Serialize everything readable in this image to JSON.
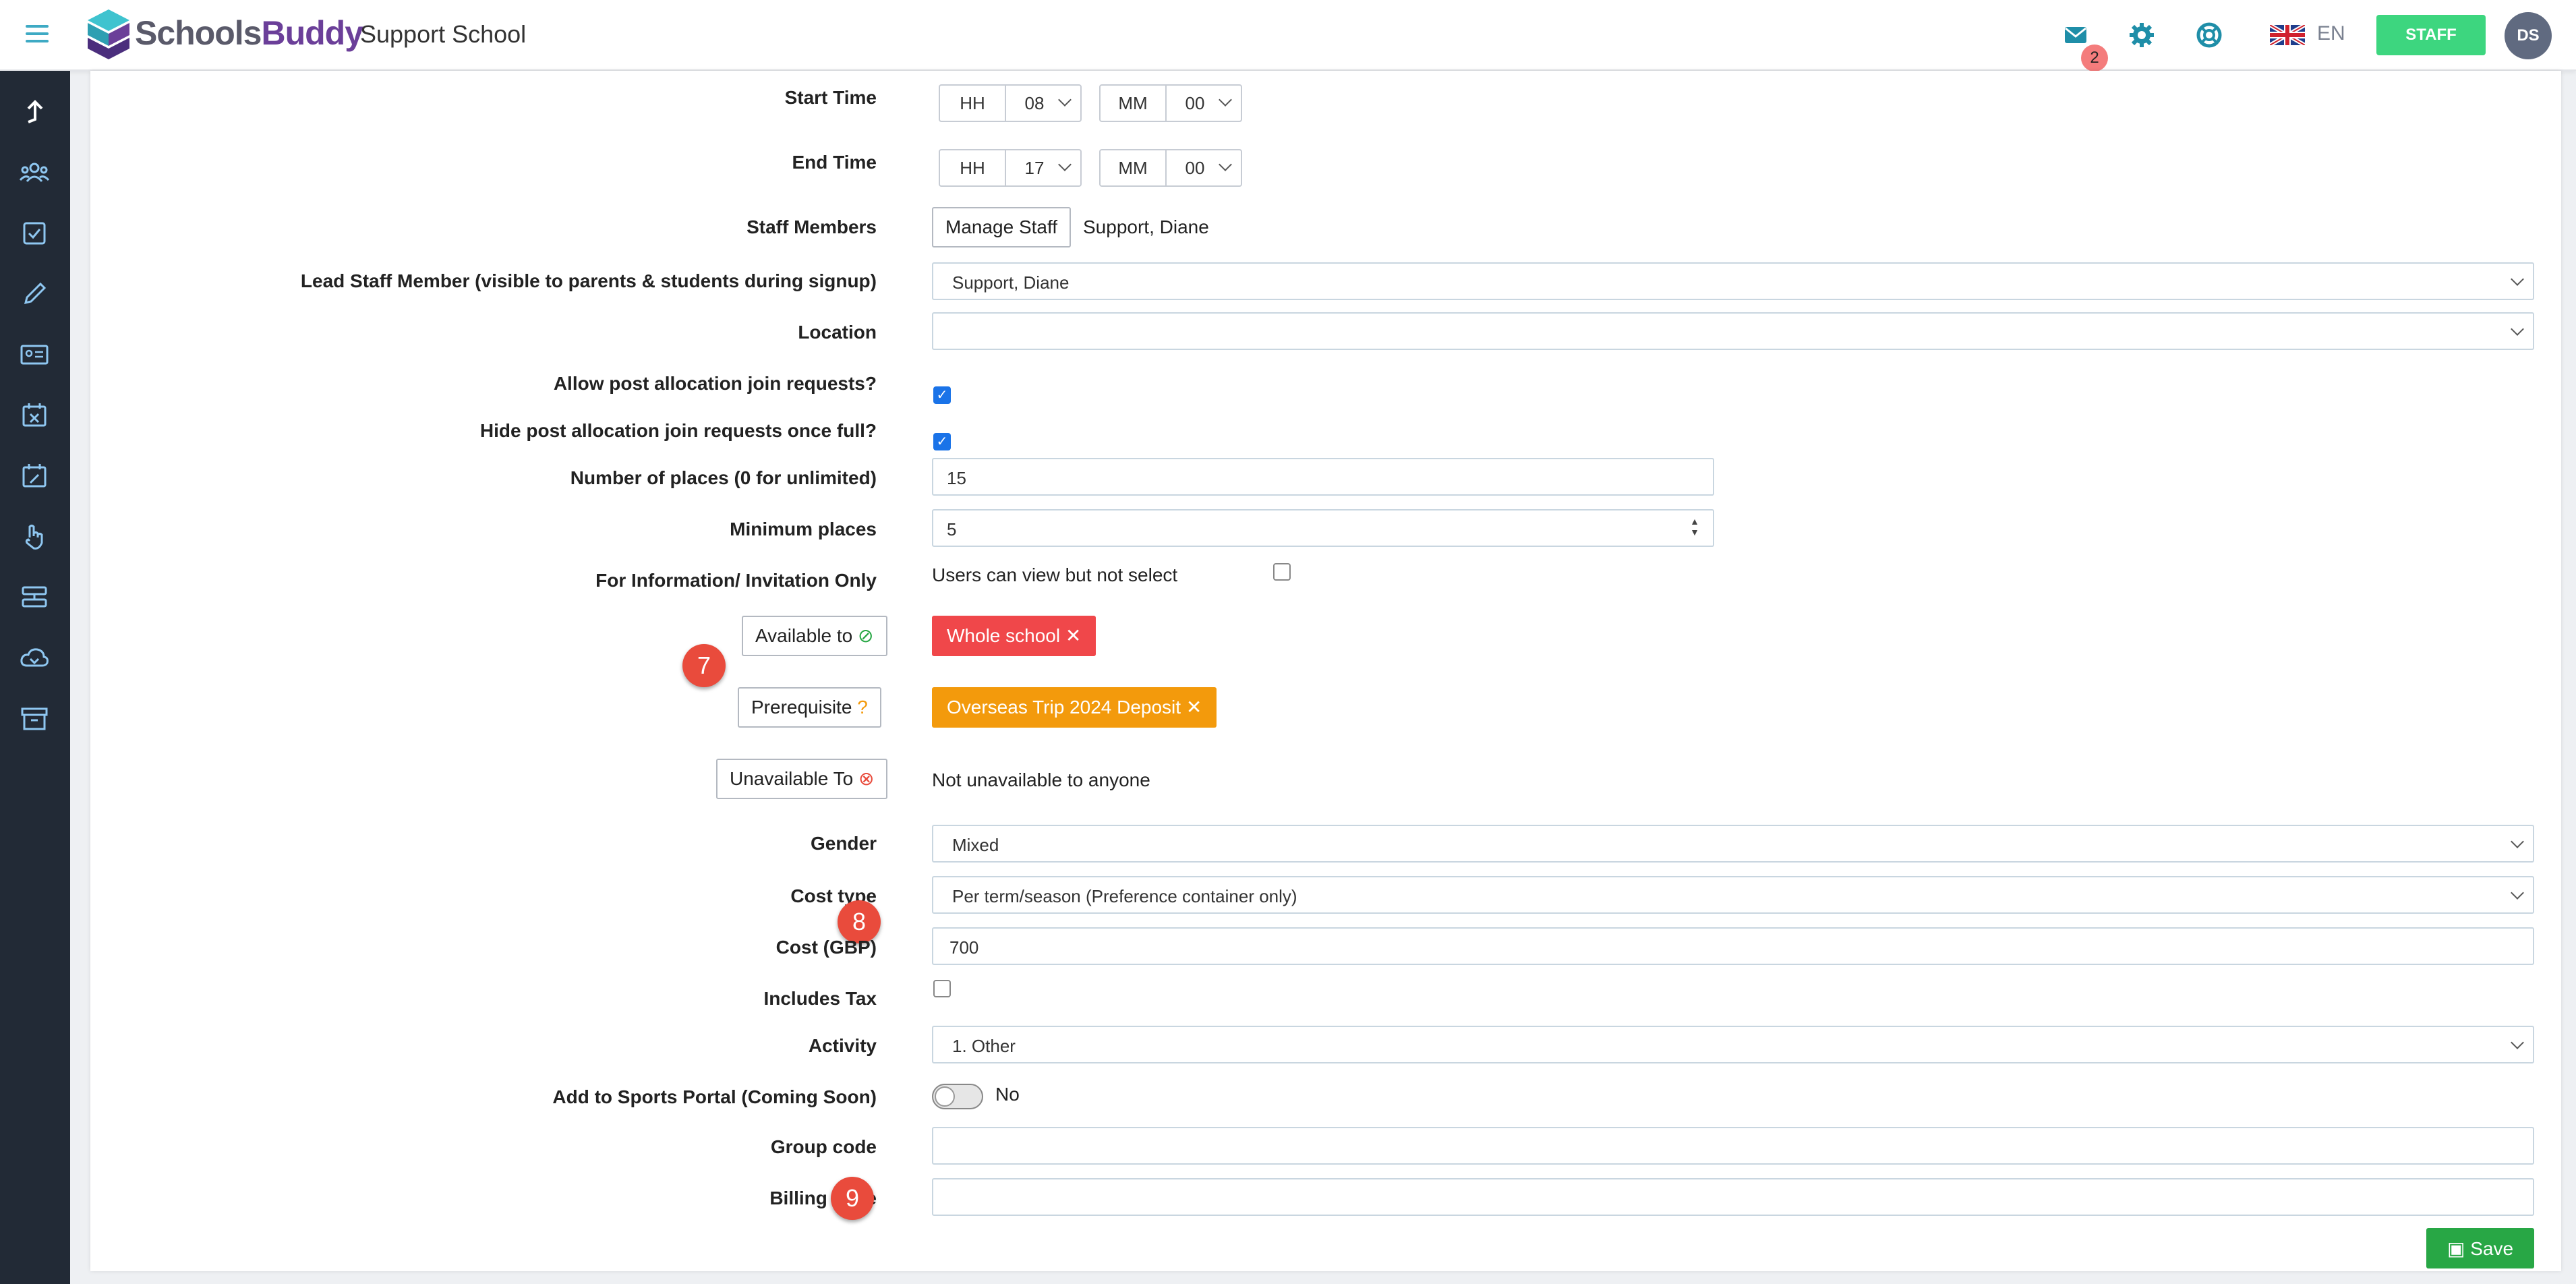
{
  "header": {
    "brand_part1": "Schools",
    "brand_part2": "Buddy",
    "school_name": "Support School",
    "notifications_count": "2",
    "language": "EN",
    "staff_label": "STAFF",
    "user_initials": "DS"
  },
  "sidebar": {
    "icons": [
      "up-arrow-icon",
      "group-icon",
      "checklist-icon",
      "pencil-icon",
      "id-card-icon",
      "calendar-cancel-icon",
      "calendar-edit-icon",
      "hand-icon",
      "server-icon",
      "cloud-download-icon",
      "archive-icon"
    ]
  },
  "form": {
    "start_time": {
      "label": "Start Time",
      "hour_prefix": "HH",
      "hour": "08",
      "min_prefix": "MM",
      "minute": "00"
    },
    "end_time": {
      "label": "End Time",
      "hour_prefix": "HH",
      "hour": "17",
      "min_prefix": "MM",
      "minute": "00"
    },
    "staff_members": {
      "label": "Staff Members",
      "button": "Manage Staff",
      "value": "Support, Diane"
    },
    "lead_staff": {
      "label": "Lead Staff Member (visible to parents & students during signup)",
      "value": "Support, Diane"
    },
    "location": {
      "label": "Location",
      "value": ""
    },
    "allow_post": {
      "label": "Allow post allocation join requests?",
      "checked": true
    },
    "hide_post": {
      "label": "Hide post allocation join requests once full?",
      "checked": true
    },
    "places": {
      "label": "Number of places (0 for unlimited)",
      "value": "15"
    },
    "min_places": {
      "label": "Minimum places",
      "value": "5"
    },
    "info_only": {
      "label": "For Information/ Invitation Only",
      "text": "Users can view but not select",
      "checked": false
    },
    "available_to": {
      "button": "Available to",
      "tag": "Whole school",
      "tag_color": "#f0474a"
    },
    "prerequisite": {
      "button": "Prerequisite",
      "tag": "Overseas Trip 2024 Deposit",
      "tag_color": "#f39a0c"
    },
    "unavailable_to": {
      "button": "Unavailable To",
      "text": "Not unavailable to anyone"
    },
    "gender": {
      "label": "Gender",
      "value": "Mixed"
    },
    "cost_type": {
      "label": "Cost type",
      "value": "Per term/season (Preference container only)"
    },
    "cost": {
      "label": "Cost (GBP)",
      "value": "700"
    },
    "includes_tax": {
      "label": "Includes Tax",
      "checked": false
    },
    "activity": {
      "label": "Activity",
      "value": "1. Other"
    },
    "sports_portal": {
      "label": "Add to Sports Portal (Coming Soon)",
      "state": "No"
    },
    "group_code": {
      "label": "Group code",
      "value": ""
    },
    "billing_code": {
      "label": "Billing code",
      "value": ""
    },
    "save_label": "Save"
  },
  "markers": [
    "7",
    "8",
    "9"
  ]
}
